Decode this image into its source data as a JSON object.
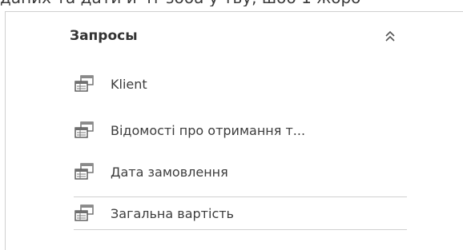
{
  "top_caption": "даних та дати й чт зоба у тьу, шоб 1 жоро",
  "nav_pane": {
    "group": {
      "title": "Запросы",
      "collapse_icon": "double-chevron-up-icon"
    },
    "items": [
      {
        "label": "Klient",
        "icon": "query-icon",
        "selected": false
      },
      {
        "label": "Відомості про отримання т...",
        "icon": "query-icon",
        "selected": false
      },
      {
        "label": "Дата замовлення",
        "icon": "query-icon",
        "selected": false
      },
      {
        "label": "Загальна вартість",
        "icon": "query-icon",
        "selected": true
      }
    ]
  }
}
